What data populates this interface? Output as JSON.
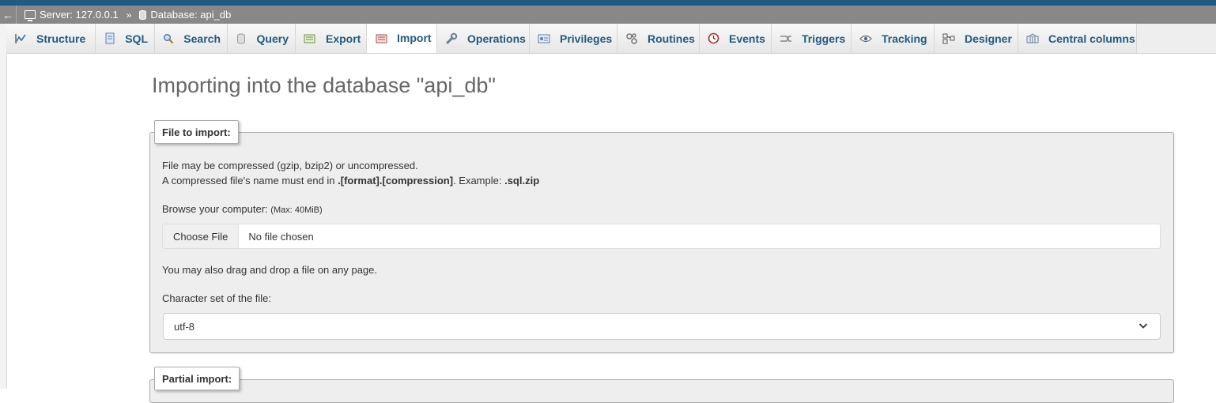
{
  "breadcrumb": {
    "back_glyph": "←",
    "server_label": "Server: 127.0.0.1",
    "separator": "»",
    "database_label": "Database: api_db"
  },
  "tabs": [
    {
      "label": "Structure",
      "icon": "structure-icon",
      "active": false
    },
    {
      "label": "SQL",
      "icon": "sql-icon",
      "active": false
    },
    {
      "label": "Search",
      "icon": "search-icon",
      "active": false
    },
    {
      "label": "Query",
      "icon": "query-icon",
      "active": false
    },
    {
      "label": "Export",
      "icon": "export-icon",
      "active": false
    },
    {
      "label": "Import",
      "icon": "import-icon",
      "active": true
    },
    {
      "label": "Operations",
      "icon": "wrench-icon",
      "active": false
    },
    {
      "label": "Privileges",
      "icon": "privileges-icon",
      "active": false
    },
    {
      "label": "Routines",
      "icon": "routines-icon",
      "active": false
    },
    {
      "label": "Events",
      "icon": "clock-icon",
      "active": false
    },
    {
      "label": "Triggers",
      "icon": "triggers-icon",
      "active": false
    },
    {
      "label": "Tracking",
      "icon": "eye-icon",
      "active": false
    },
    {
      "label": "Designer",
      "icon": "designer-icon",
      "active": false
    },
    {
      "label": "Central columns",
      "icon": "columns-icon",
      "active": false
    }
  ],
  "main": {
    "title": "Importing into the database \"api_db\"",
    "file_import": {
      "legend": "File to import:",
      "line1": "File may be compressed (gzip, bzip2) or uncompressed.",
      "line2_prefix": "A compressed file's name must end in ",
      "line2_format": ".[format].[compression]",
      "line2_mid": ". Example: ",
      "line2_example": ".sql.zip",
      "browse_label": "Browse your computer: ",
      "max_size": "(Max: 40MiB)",
      "choose_button": "Choose File",
      "file_status": "No file chosen",
      "drag_note": "You may also drag and drop a file on any page.",
      "charset_label": "Character set of the file:",
      "charset_value": "utf-8"
    },
    "partial_import": {
      "legend": "Partial import:"
    }
  },
  "colors": {
    "accent": "#235a81",
    "breadcrumb_bg": "#888888",
    "panel_bg": "#eeeeee"
  }
}
